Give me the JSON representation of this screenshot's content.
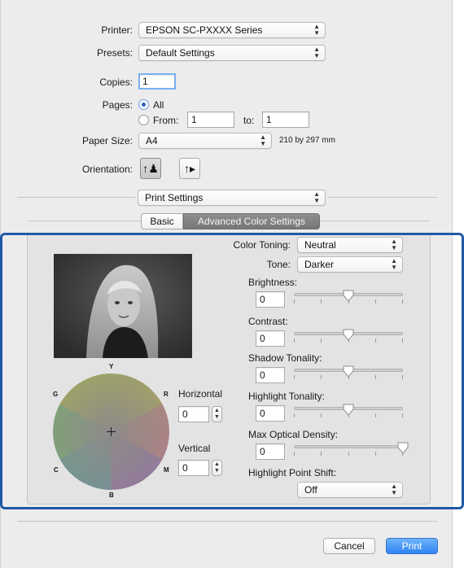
{
  "printer": {
    "label": "Printer:",
    "value": "EPSON SC-PXXXX Series"
  },
  "presets": {
    "label": "Presets:",
    "value": "Default Settings"
  },
  "copies": {
    "label": "Copies:",
    "value": "1"
  },
  "pages": {
    "label": "Pages:",
    "all_label": "All",
    "from_label": "From:",
    "from_value": "1",
    "to_label": "to:",
    "to_value": "1"
  },
  "paper_size": {
    "label": "Paper Size:",
    "value": "A4",
    "dimensions": "210 by 297 mm"
  },
  "orientation": {
    "label": "Orientation:"
  },
  "section_menu": {
    "value": "Print Settings"
  },
  "tabs": [
    {
      "label": "Basic"
    },
    {
      "label": "Advanced Color Settings"
    }
  ],
  "color_wheel": {
    "top": "Y",
    "left_top": "G",
    "right_top": "R",
    "left_bottom": "C",
    "right_bottom": "M",
    "bottom": "B"
  },
  "horizontal": {
    "label": "Horizontal",
    "value": "0"
  },
  "vertical": {
    "label": "Vertical",
    "value": "0"
  },
  "color_toning": {
    "label": "Color Toning:",
    "value": "Neutral"
  },
  "tone": {
    "label": "Tone:",
    "value": "Darker"
  },
  "sliders": [
    {
      "label": "Brightness:",
      "value": "0",
      "level": 0.5
    },
    {
      "label": "Contrast:",
      "value": "0",
      "level": 0.5
    },
    {
      "label": "Shadow Tonality:",
      "value": "0",
      "level": 0.5
    },
    {
      "label": "Highlight Tonality:",
      "value": "0",
      "level": 0.5
    },
    {
      "label": "Max Optical Density:",
      "value": "0",
      "level": 1.0
    }
  ],
  "highlight_point_shift": {
    "label": "Highlight Point Shift:",
    "value": "Off"
  },
  "buttons": {
    "cancel": "Cancel",
    "print": "Print"
  },
  "colors": {
    "accent": "#2f84f3",
    "highlight_frame": "#1f5aa6"
  }
}
